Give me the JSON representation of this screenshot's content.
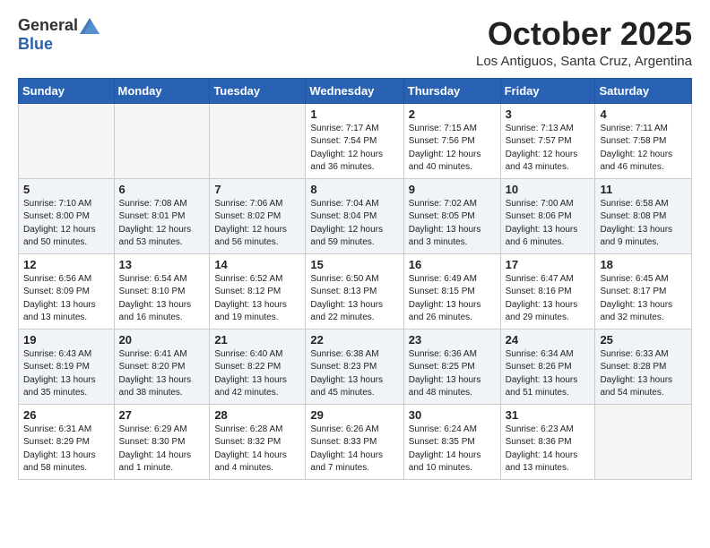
{
  "logo": {
    "general": "General",
    "blue": "Blue"
  },
  "title": "October 2025",
  "subtitle": "Los Antiguos, Santa Cruz, Argentina",
  "days_of_week": [
    "Sunday",
    "Monday",
    "Tuesday",
    "Wednesday",
    "Thursday",
    "Friday",
    "Saturday"
  ],
  "weeks": [
    [
      {
        "day": "",
        "info": ""
      },
      {
        "day": "",
        "info": ""
      },
      {
        "day": "",
        "info": ""
      },
      {
        "day": "1",
        "info": "Sunrise: 7:17 AM\nSunset: 7:54 PM\nDaylight: 12 hours\nand 36 minutes."
      },
      {
        "day": "2",
        "info": "Sunrise: 7:15 AM\nSunset: 7:56 PM\nDaylight: 12 hours\nand 40 minutes."
      },
      {
        "day": "3",
        "info": "Sunrise: 7:13 AM\nSunset: 7:57 PM\nDaylight: 12 hours\nand 43 minutes."
      },
      {
        "day": "4",
        "info": "Sunrise: 7:11 AM\nSunset: 7:58 PM\nDaylight: 12 hours\nand 46 minutes."
      }
    ],
    [
      {
        "day": "5",
        "info": "Sunrise: 7:10 AM\nSunset: 8:00 PM\nDaylight: 12 hours\nand 50 minutes."
      },
      {
        "day": "6",
        "info": "Sunrise: 7:08 AM\nSunset: 8:01 PM\nDaylight: 12 hours\nand 53 minutes."
      },
      {
        "day": "7",
        "info": "Sunrise: 7:06 AM\nSunset: 8:02 PM\nDaylight: 12 hours\nand 56 minutes."
      },
      {
        "day": "8",
        "info": "Sunrise: 7:04 AM\nSunset: 8:04 PM\nDaylight: 12 hours\nand 59 minutes."
      },
      {
        "day": "9",
        "info": "Sunrise: 7:02 AM\nSunset: 8:05 PM\nDaylight: 13 hours\nand 3 minutes."
      },
      {
        "day": "10",
        "info": "Sunrise: 7:00 AM\nSunset: 8:06 PM\nDaylight: 13 hours\nand 6 minutes."
      },
      {
        "day": "11",
        "info": "Sunrise: 6:58 AM\nSunset: 8:08 PM\nDaylight: 13 hours\nand 9 minutes."
      }
    ],
    [
      {
        "day": "12",
        "info": "Sunrise: 6:56 AM\nSunset: 8:09 PM\nDaylight: 13 hours\nand 13 minutes."
      },
      {
        "day": "13",
        "info": "Sunrise: 6:54 AM\nSunset: 8:10 PM\nDaylight: 13 hours\nand 16 minutes."
      },
      {
        "day": "14",
        "info": "Sunrise: 6:52 AM\nSunset: 8:12 PM\nDaylight: 13 hours\nand 19 minutes."
      },
      {
        "day": "15",
        "info": "Sunrise: 6:50 AM\nSunset: 8:13 PM\nDaylight: 13 hours\nand 22 minutes."
      },
      {
        "day": "16",
        "info": "Sunrise: 6:49 AM\nSunset: 8:15 PM\nDaylight: 13 hours\nand 26 minutes."
      },
      {
        "day": "17",
        "info": "Sunrise: 6:47 AM\nSunset: 8:16 PM\nDaylight: 13 hours\nand 29 minutes."
      },
      {
        "day": "18",
        "info": "Sunrise: 6:45 AM\nSunset: 8:17 PM\nDaylight: 13 hours\nand 32 minutes."
      }
    ],
    [
      {
        "day": "19",
        "info": "Sunrise: 6:43 AM\nSunset: 8:19 PM\nDaylight: 13 hours\nand 35 minutes."
      },
      {
        "day": "20",
        "info": "Sunrise: 6:41 AM\nSunset: 8:20 PM\nDaylight: 13 hours\nand 38 minutes."
      },
      {
        "day": "21",
        "info": "Sunrise: 6:40 AM\nSunset: 8:22 PM\nDaylight: 13 hours\nand 42 minutes."
      },
      {
        "day": "22",
        "info": "Sunrise: 6:38 AM\nSunset: 8:23 PM\nDaylight: 13 hours\nand 45 minutes."
      },
      {
        "day": "23",
        "info": "Sunrise: 6:36 AM\nSunset: 8:25 PM\nDaylight: 13 hours\nand 48 minutes."
      },
      {
        "day": "24",
        "info": "Sunrise: 6:34 AM\nSunset: 8:26 PM\nDaylight: 13 hours\nand 51 minutes."
      },
      {
        "day": "25",
        "info": "Sunrise: 6:33 AM\nSunset: 8:28 PM\nDaylight: 13 hours\nand 54 minutes."
      }
    ],
    [
      {
        "day": "26",
        "info": "Sunrise: 6:31 AM\nSunset: 8:29 PM\nDaylight: 13 hours\nand 58 minutes."
      },
      {
        "day": "27",
        "info": "Sunrise: 6:29 AM\nSunset: 8:30 PM\nDaylight: 14 hours\nand 1 minute."
      },
      {
        "day": "28",
        "info": "Sunrise: 6:28 AM\nSunset: 8:32 PM\nDaylight: 14 hours\nand 4 minutes."
      },
      {
        "day": "29",
        "info": "Sunrise: 6:26 AM\nSunset: 8:33 PM\nDaylight: 14 hours\nand 7 minutes."
      },
      {
        "day": "30",
        "info": "Sunrise: 6:24 AM\nSunset: 8:35 PM\nDaylight: 14 hours\nand 10 minutes."
      },
      {
        "day": "31",
        "info": "Sunrise: 6:23 AM\nSunset: 8:36 PM\nDaylight: 14 hours\nand 13 minutes."
      },
      {
        "day": "",
        "info": ""
      }
    ]
  ]
}
